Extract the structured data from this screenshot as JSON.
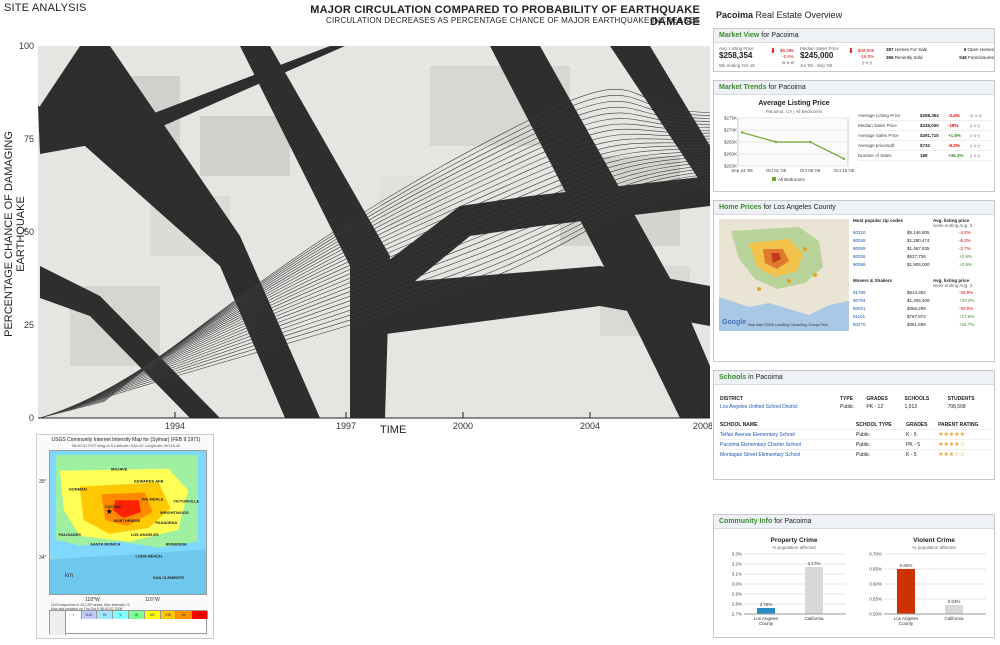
{
  "header": {
    "site_title": "SITE ANALYSIS",
    "main_title": "MAJOR CIRCULATION COMPARED TO PROBABILITY OF EARTHQUAKE DAMAGE",
    "subtitle": "CIRCULATION DECREASES AS PERCENTAGE CHANCE OF MAJOR EARTHQUAKE INCREASES"
  },
  "chart_data": {
    "type": "line",
    "ylabel": "PERCENTAGE CHANCE OF DAMAGING EARTHQUAKE",
    "xlabel": "TIME",
    "yticks": [
      "100",
      "75",
      "50",
      "25",
      "0"
    ],
    "xticks": [
      "1994",
      "1997",
      "2000",
      "2004",
      "2008"
    ],
    "ylim": [
      0,
      100
    ],
    "background": "aerial site photo with road paths",
    "road_color": "#2e2e2e"
  },
  "seismic": {
    "title": "USGS Community Internet Intensity Map for (Sylmar) (FEB 9 1971)",
    "sub": "06:00:41 PST Mag=6.6 Latitude=N34.40 Longitude=W118.40",
    "map_labels": [
      "MOJAVE",
      "GORMAN",
      "EDWARDS AFB",
      "PALMDALE",
      "VICTORVILLE",
      "CASTAIC",
      "NORTHRIDGE",
      "LOS ANGELES",
      "PASADENA",
      "WRIGHTWOOD",
      "SANTA MONICA",
      "LONG BEACH",
      "RIVERSIDE",
      "PALISADES",
      "SAN CLEMENTE"
    ],
    "lat_labels": [
      "35°",
      "34°"
    ],
    "lon_labels": [
      "118°W",
      "116°W"
    ],
    "scale_unit": "km",
    "response_text": "1140 responses in 201 ZIP areas. Max intensity: IX",
    "updated_text": "Map last updated on Thu Oct 9 08:52:57 2008",
    "legend_levels": [
      "I",
      "II-III",
      "IV",
      "V",
      "VI",
      "VII",
      "VIII",
      "IX",
      "X+"
    ],
    "legend_colors": [
      "#ffffff",
      "#bfccff",
      "#a0e6ff",
      "#80ffff",
      "#7aff93",
      "#ffff00",
      "#ffc800",
      "#ff9100",
      "#ff0000"
    ]
  },
  "rp": {
    "title_bold": "Pacoima",
    "title_rest": " Real Estate Overview",
    "market_view": {
      "head_bold": "Market View",
      "head_rest": " for Pacoima",
      "avg_label": "Avg. Listing Price",
      "avg_val": "$258,354",
      "avg_sub": "Wk ending Oct 15",
      "avg_change": "$6,396",
      "avg_pct": "-2.4%",
      "avg_period": "w-o-w",
      "median_label": "Median Sales Price",
      "median_val": "$245,000",
      "median_sub": "Jul '08 - Sep '08",
      "median_change": "$49,000",
      "median_pct": "-16.0%",
      "median_period": "y-o-y",
      "stats": [
        {
          "n": "387",
          "t": "Homes For Sale"
        },
        {
          "n": "6",
          "t": "Open Homes"
        },
        {
          "n": "366",
          "t": "Recently Sold"
        },
        {
          "n": "548",
          "t": "Foreclosures"
        }
      ]
    },
    "market_trends": {
      "head_bold": "Market Trends",
      "head_rest": " for Pacoima",
      "chart_title": "Average Listing Price",
      "chart_sub": "Pacoima, CA | All Bedrooms",
      "y_ticks": [
        "$275K",
        "$270K",
        "$265K",
        "$260K",
        "$255K"
      ],
      "x_ticks": [
        "Sep 24 '08",
        "Oct 01 '08",
        "Oct 08 '08",
        "Oct 15 '08"
      ],
      "values": [
        269,
        265,
        265,
        258
      ],
      "legend": "All Bedrooms",
      "rows": [
        {
          "label": "Average Listing Price",
          "val": "$258,354",
          "pct": "-2.4%",
          "per": "w-o-w",
          "dir": "down"
        },
        {
          "label": "Median Sales Price",
          "val": "$245,000",
          "pct": "-18%",
          "per": "y-o-y",
          "dir": "down"
        },
        {
          "label": "Average Sales Price",
          "val": "$291,715",
          "pct": "+1.8%",
          "per": "y-o-y",
          "dir": "up"
        },
        {
          "label": "Average price/sqft",
          "val": "$732",
          "pct": "-5.3%",
          "per": "y-o-y",
          "dir": "down"
        },
        {
          "label": "Number of Sales",
          "val": "189",
          "pct": "+36.3%",
          "per": "y-o-y",
          "dir": "up"
        }
      ]
    },
    "home_prices": {
      "head_bold": "Home Prices",
      "head_rest": " for Los Angeles County",
      "map_copyright": "Map data ©2008 LeadDog Consulting, Europa Tech",
      "map_logo": "Google",
      "popular_title": "Most popular zip codes",
      "avg_title": "Avg. listing price",
      "avg_sub": "week ending Aug. 3",
      "popular": [
        {
          "zip": "90210",
          "price": "$5,146,805",
          "pct": "-4.2%"
        },
        {
          "zip": "90049",
          "price": "$1,290,474",
          "pct": "-6.2%"
        },
        {
          "zip": "90069",
          "price": "$1,467,835",
          "pct": "-2.7%"
        },
        {
          "zip": "90026",
          "price": "$627,736",
          "pct": "+2.8%"
        },
        {
          "zip": "90069",
          "price": "$1,905,000",
          "pct": "+2.6%"
        }
      ],
      "movers_title": "Movers & Shakers",
      "movers": [
        {
          "zip": "91759",
          "price": "$613,352",
          "pct": "-25.9%"
        },
        {
          "zip": "90704",
          "price": "$1,405,409",
          "pct": "+20.3%"
        },
        {
          "zip": "90021",
          "price": "$366,299",
          "pct": "-20.0%"
        },
        {
          "zip": "91101",
          "price": "$767,872",
          "pct": "+17.6%"
        },
        {
          "zip": "90270",
          "price": "$361,659",
          "pct": "+16.7%"
        }
      ]
    },
    "schools": {
      "head_bold": "Schools",
      "head_rest": " in Pacoima",
      "dist_headers": [
        "DISTRICT",
        "TYPE",
        "GRADES",
        "SCHOOLS",
        "STUDENTS"
      ],
      "district": {
        "name": "Los Angeles Unified School District",
        "type": "Public",
        "grades": "PK - 12",
        "schools": "1,013",
        "students": "708,568"
      },
      "school_headers": [
        "SCHOOL NAME",
        "SCHOOL TYPE",
        "GRADES",
        "PARENT RATING"
      ],
      "list": [
        {
          "name": "Telfair Avenue Elementary School",
          "type": "Public",
          "grades": "K - 5",
          "rating": "★★★★★"
        },
        {
          "name": "Pacoima Elementary Charter School",
          "type": "Public",
          "grades": "PK - 5",
          "rating": "★★★★☆"
        },
        {
          "name": "Montague Street Elementary School",
          "type": "Public",
          "grades": "K - 5",
          "rating": "★★★☆☆"
        }
      ]
    },
    "community": {
      "head_bold": "Community Info",
      "head_rest": " for Pacoima",
      "property": {
        "title": "Property Crime",
        "sub": "% population affected",
        "y_ticks": [
          "3.3%",
          "3.2%",
          "3.1%",
          "3.0%",
          "2.9%",
          "2.8%",
          "2.7%"
        ],
        "ylim": [
          2.7,
          3.3
        ],
        "bars": [
          {
            "label": "Los Angeles County",
            "value": 2.76,
            "text": "2.76%",
            "color": "#2b8cc4"
          },
          {
            "label": "California",
            "value": 3.17,
            "text": "3.17%",
            "color": "#d8d8d8"
          }
        ]
      },
      "violent": {
        "title": "Violent Crime",
        "sub": "% population affected",
        "y_ticks": [
          "0.70%",
          "0.65%",
          "0.60%",
          "0.55%",
          "0.50%"
        ],
        "ylim": [
          0.5,
          0.7
        ],
        "bars": [
          {
            "label": "Los Angeles County",
            "value": 0.65,
            "text": "0.65%",
            "color": "#cc3300"
          },
          {
            "label": "California",
            "value": 0.53,
            "text": "0.53%",
            "color": "#d8d8d8"
          }
        ]
      }
    }
  }
}
